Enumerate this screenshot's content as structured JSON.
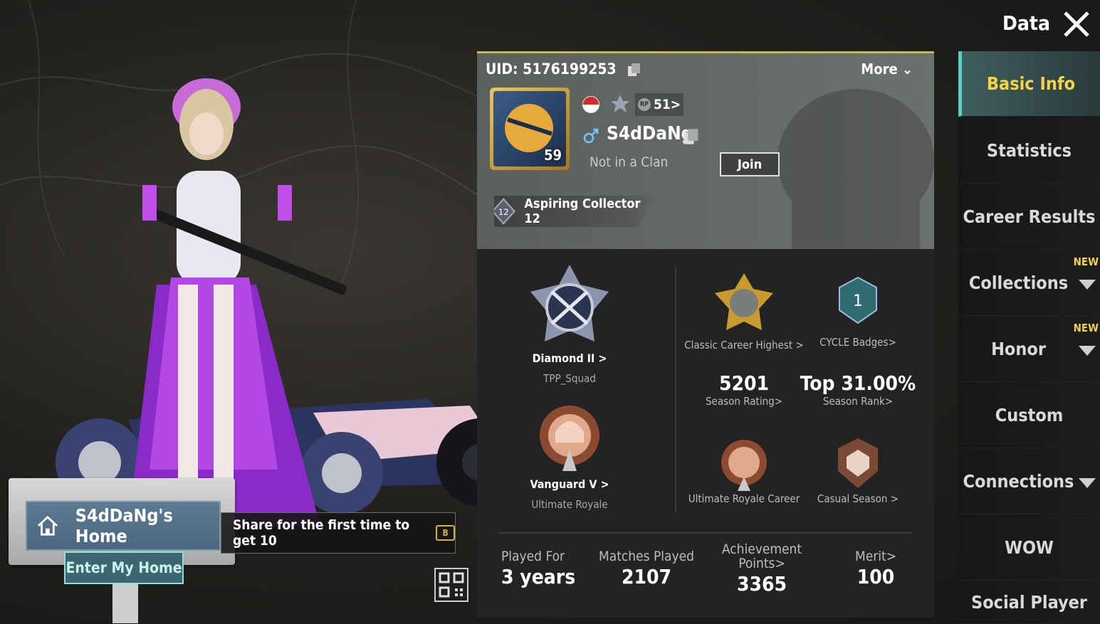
{
  "header": {
    "title": "Data",
    "close_icon": "close-icon"
  },
  "profile": {
    "uid": "UID: 5176199253",
    "more_label": "More",
    "avatar_level": "59",
    "rp_label": "51>",
    "name": "S4dDaNg",
    "clan": "Not in a Clan",
    "join_label": "Join",
    "title": "Aspiring Collector 12",
    "title_badge": "12",
    "flag_colors": [
      "#d52b2b",
      "#ffffff"
    ]
  },
  "ranks": {
    "tpp": {
      "tier": "Diamond II >",
      "mode": "TPP_Squad"
    },
    "ultimate": {
      "tier": "Vanguard V >",
      "mode": "Ultimate Royale"
    }
  },
  "badges": {
    "classic": "Classic Career Highest >",
    "cycle": "CYCLE Badges>",
    "cycle_number": "1",
    "season_rating_value": "5201",
    "season_rating_label": "Season Rating>",
    "season_rank_value": "Top 31.00%",
    "season_rank_label": "Season Rank>",
    "ur_career": "Ultimate Royale Career",
    "casual": "Casual Season >"
  },
  "summary": {
    "played_for_label": "Played For",
    "played_for_value": "3 years",
    "matches_label": "Matches Played",
    "matches_value": "2107",
    "achievement_label_1": "Achievement",
    "achievement_label_2": "Points>",
    "achievement_value": "3365",
    "merit_label": "Merit>",
    "merit_value": "100"
  },
  "home": {
    "label": "S4dDaNg's Home",
    "enter_label": "Enter My Home",
    "share_text": "Share for the first time to get 10",
    "coin_label": "B"
  },
  "sidebar": {
    "items": [
      {
        "label": "Basic Info"
      },
      {
        "label": "Statistics"
      },
      {
        "label": "Career Results"
      },
      {
        "label": "Collections",
        "badge": "NEW"
      },
      {
        "label": "Honor",
        "badge": "NEW"
      },
      {
        "label": "Custom"
      },
      {
        "label": "Connections"
      },
      {
        "label": "WOW"
      },
      {
        "label": "Social Player"
      }
    ]
  },
  "colors": {
    "accent": "#f3d34a",
    "teal": "#58d0c6",
    "panel": "#232323"
  }
}
